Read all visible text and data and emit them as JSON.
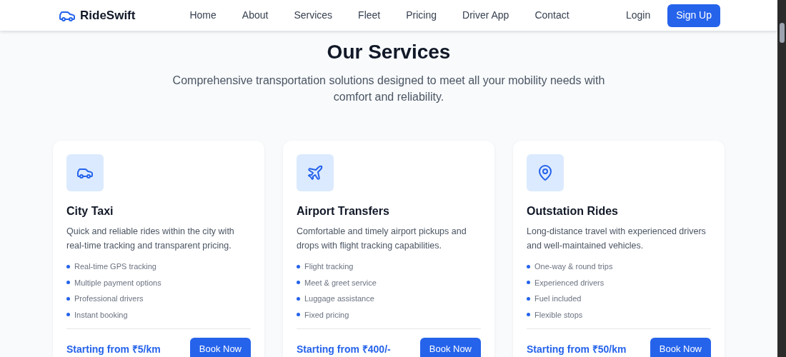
{
  "brand": {
    "name": "RideSwift"
  },
  "nav": [
    "Home",
    "About",
    "Services",
    "Fleet",
    "Pricing",
    "Driver App",
    "Contact"
  ],
  "auth": {
    "login": "Login",
    "signup": "Sign Up"
  },
  "section": {
    "title": "Our Services",
    "subtitle": "Comprehensive transportation solutions designed to meet all your mobility needs with comfort and reliability."
  },
  "services": [
    {
      "title": "City Taxi",
      "description": "Quick and reliable rides within the city with real-time tracking and transparent pricing.",
      "features": [
        "Real-time GPS tracking",
        "Multiple payment options",
        "Professional drivers",
        "Instant booking"
      ],
      "price": "Starting from ₹5/km",
      "button": "Book Now"
    },
    {
      "title": "Airport Transfers",
      "description": "Comfortable and timely airport pickups and drops with flight tracking capabilities.",
      "features": [
        "Flight tracking",
        "Meet & greet service",
        "Luggage assistance",
        "Fixed pricing"
      ],
      "price": "Starting from ₹400/-",
      "button": "Book Now"
    },
    {
      "title": "Outstation Rides",
      "description": "Long-distance travel with experienced drivers and well-maintained vehicles.",
      "features": [
        "One-way & round trips",
        "Experienced drivers",
        "Fuel included",
        "Flexible stops"
      ],
      "price": "Starting from ₹50/km",
      "button": "Book Now"
    }
  ]
}
